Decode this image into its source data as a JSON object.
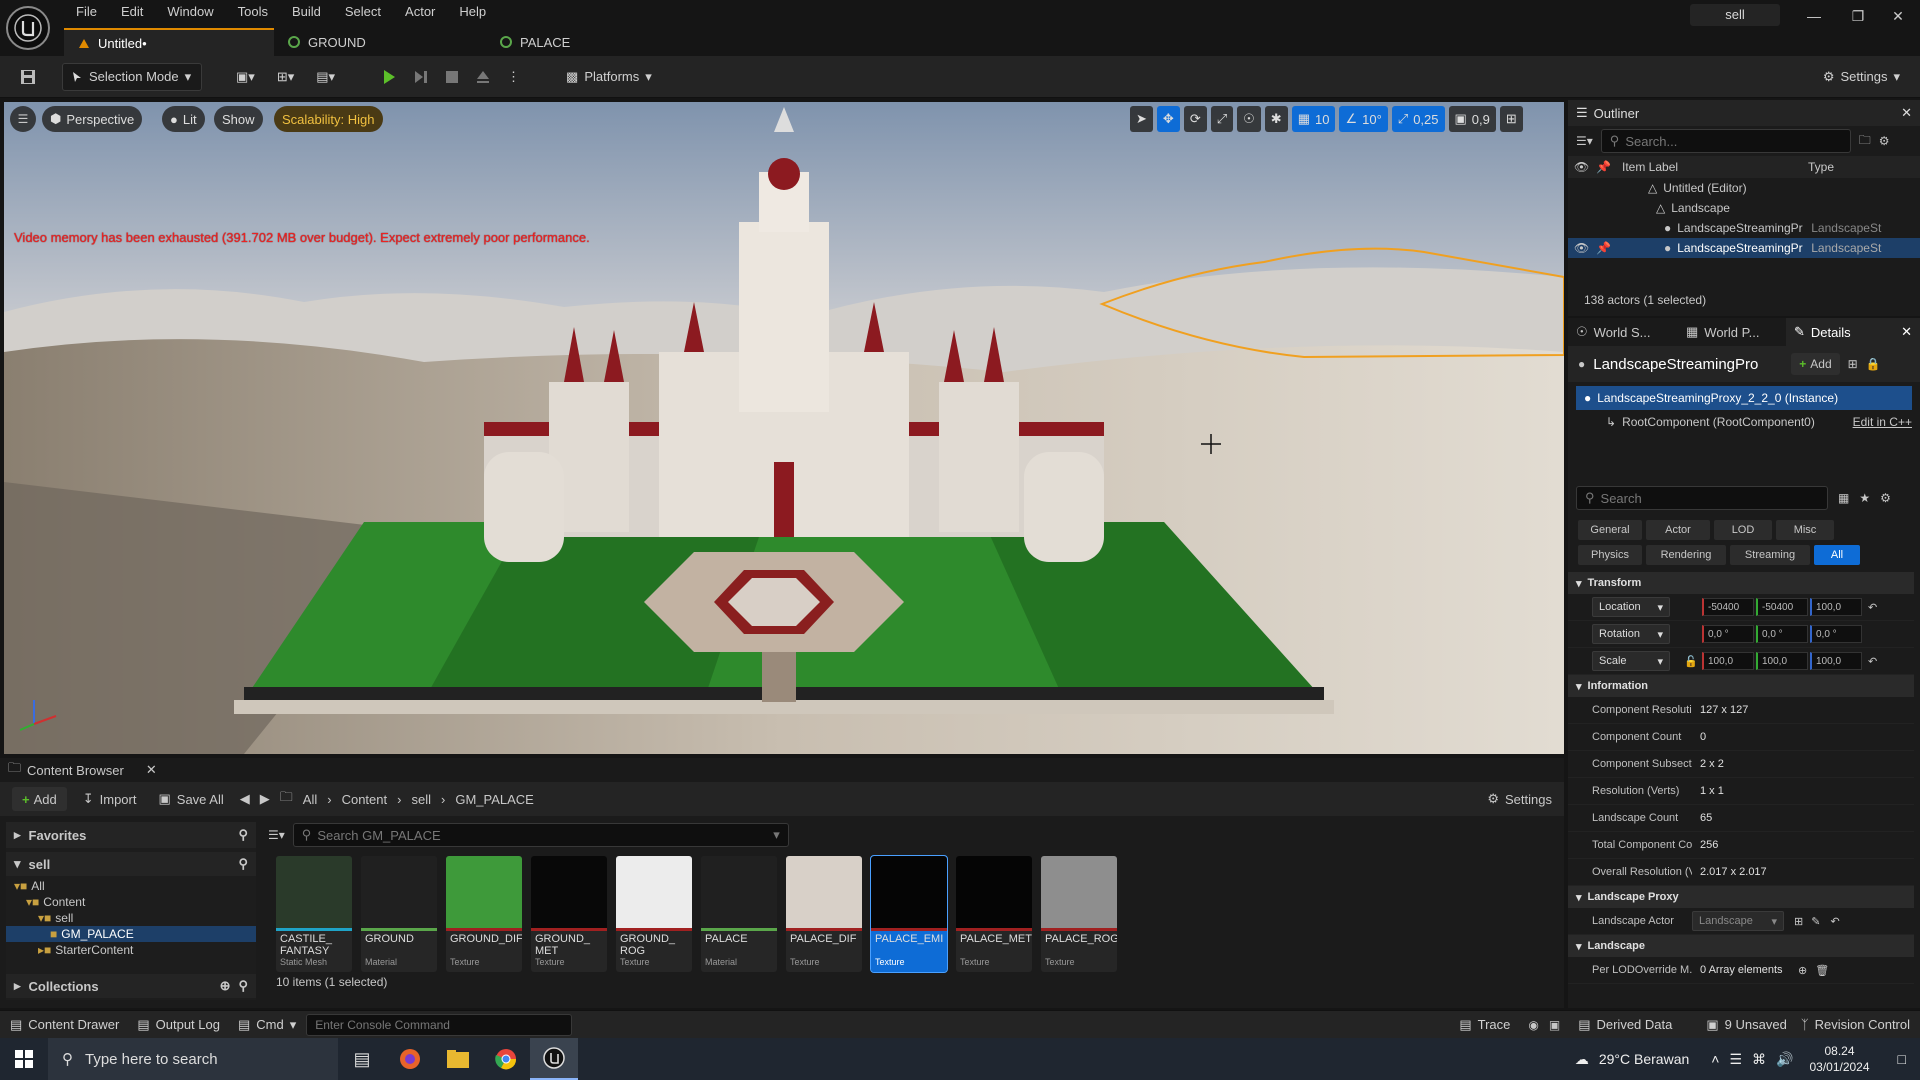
{
  "menu": [
    "File",
    "Edit",
    "Window",
    "Tools",
    "Build",
    "Select",
    "Actor",
    "Help"
  ],
  "doc_tabs": [
    {
      "label": "Untitled•"
    },
    {
      "label": "GROUND"
    },
    {
      "label": "PALACE"
    }
  ],
  "project_name": "sell",
  "toolbar": {
    "selection_mode": "Selection Mode",
    "platforms": "Platforms",
    "settings": "Settings"
  },
  "viewport": {
    "perspective": "Perspective",
    "lit": "Lit",
    "show": "Show",
    "scalability": "Scalability: High",
    "grid_snap": "10",
    "rotation_snap": "10°",
    "scale_snap": "0,25",
    "camera_speed": "0,9",
    "warning": "Video memory has been exhausted (391.702 MB over budget). Expect extremely poor performance."
  },
  "outliner": {
    "title": "Outliner",
    "search_placeholder": "Search...",
    "col_label": "Item Label",
    "col_type": "Type",
    "rows": [
      {
        "label": "Untitled (Editor)",
        "type": ""
      },
      {
        "label": "Landscape",
        "type": ""
      },
      {
        "label": "LandscapeStreamingPr",
        "type": "LandscapeSt"
      },
      {
        "label": "LandscapeStreamingPr",
        "type": "LandscapeSt"
      }
    ],
    "status": "138 actors (1 selected)"
  },
  "details": {
    "tabs": [
      "World S...",
      "World P...",
      "Details"
    ],
    "actor_name": "LandscapeStreamingPro",
    "add_label": "Add",
    "instance_label": "LandscapeStreamingProxy_2_2_0 (Instance)",
    "root_component": "RootComponent (RootComponent0)",
    "edit_cpp": "Edit in C++",
    "search_placeholder": "Search",
    "filters_row1": [
      "General",
      "Actor",
      "LOD",
      "Misc"
    ],
    "filters_row2": [
      "Physics",
      "Rendering",
      "Streaming",
      "All"
    ],
    "transform": {
      "title": "Transform",
      "location": {
        "label": "Location",
        "x": "-50400",
        "y": "-50400",
        "z": "100,0"
      },
      "rotation": {
        "label": "Rotation",
        "x": "0,0 °",
        "y": "0,0 °",
        "z": "0,0 °"
      },
      "scale": {
        "label": "Scale",
        "x": "100,0",
        "y": "100,0",
        "z": "100,0"
      }
    },
    "information": {
      "title": "Information",
      "rows": [
        {
          "label": "Component Resolutio",
          "value": "127 x 127"
        },
        {
          "label": "Component Count",
          "value": "0"
        },
        {
          "label": "Component Subsectic",
          "value": "2 x 2"
        },
        {
          "label": "Resolution (Verts)",
          "value": "1 x 1"
        },
        {
          "label": "Landscape Count",
          "value": "65"
        },
        {
          "label": "Total Component Cou",
          "value": "256"
        },
        {
          "label": "Overall Resolution (Ve",
          "value": "2.017 x 2.017"
        }
      ]
    },
    "landscape_proxy": {
      "title": "Landscape Proxy",
      "actor_label": "Landscape Actor",
      "actor_value": "Landscape"
    },
    "landscape": {
      "title": "Landscape",
      "lod_label": "Per LODOverride M...",
      "lod_value": "0 Array elements"
    }
  },
  "content_browser": {
    "title": "Content Browser",
    "add": "Add",
    "import": "Import",
    "save_all": "Save All",
    "breadcrumb": [
      "All",
      "Content",
      "sell",
      "GM_PALACE"
    ],
    "settings": "Settings",
    "favorites": "Favorites",
    "root": "sell",
    "tree": [
      "All",
      "Content",
      "sell",
      "GM_PALACE",
      "StarterContent"
    ],
    "collections": "Collections",
    "search_placeholder": "Search GM_PALACE",
    "assets": [
      {
        "name": "CASTILE_ FANTASY",
        "type": "Static Mesh",
        "color": "#2a3a2a",
        "strip": "#1fa3c7"
      },
      {
        "name": "GROUND",
        "type": "Material",
        "color": "#202020",
        "strip": "#5aa64a"
      },
      {
        "name": "GROUND_DIF",
        "type": "Texture",
        "color": "#3e9a3a",
        "strip": "#a02020"
      },
      {
        "name": "GROUND_ MET",
        "type": "Texture",
        "color": "#080808",
        "strip": "#a02020"
      },
      {
        "name": "GROUND_ ROG",
        "type": "Texture",
        "color": "#ececec",
        "strip": "#a02020"
      },
      {
        "name": "PALACE",
        "type": "Material",
        "color": "#202020",
        "strip": "#5aa64a"
      },
      {
        "name": "PALACE_DIF",
        "type": "Texture",
        "color": "#d8d0c8",
        "strip": "#a02020"
      },
      {
        "name": "PALACE_EMI",
        "type": "Texture",
        "color": "#050505",
        "strip": "#a02020"
      },
      {
        "name": "PALACE_MET",
        "type": "Texture",
        "color": "#050505",
        "strip": "#a02020"
      },
      {
        "name": "PALACE_ROG",
        "type": "Texture",
        "color": "#8e8e8e",
        "strip": "#a02020"
      }
    ],
    "item_count": "10 items (1 selected)"
  },
  "statusbar": {
    "content_drawer": "Content Drawer",
    "output_log": "Output Log",
    "cmd": "Cmd",
    "console_placeholder": "Enter Console Command",
    "trace": "Trace",
    "derived_data": "Derived Data",
    "unsaved": "9 Unsaved",
    "revision_control": "Revision Control"
  },
  "taskbar": {
    "search_placeholder": "Type here to search",
    "weather": "29°C  Berawan",
    "time": "08.24",
    "date": "03/01/2024"
  },
  "colors": {
    "accent": "#e08a00",
    "selection": "#0e6cd6",
    "warning": "#e22222"
  }
}
